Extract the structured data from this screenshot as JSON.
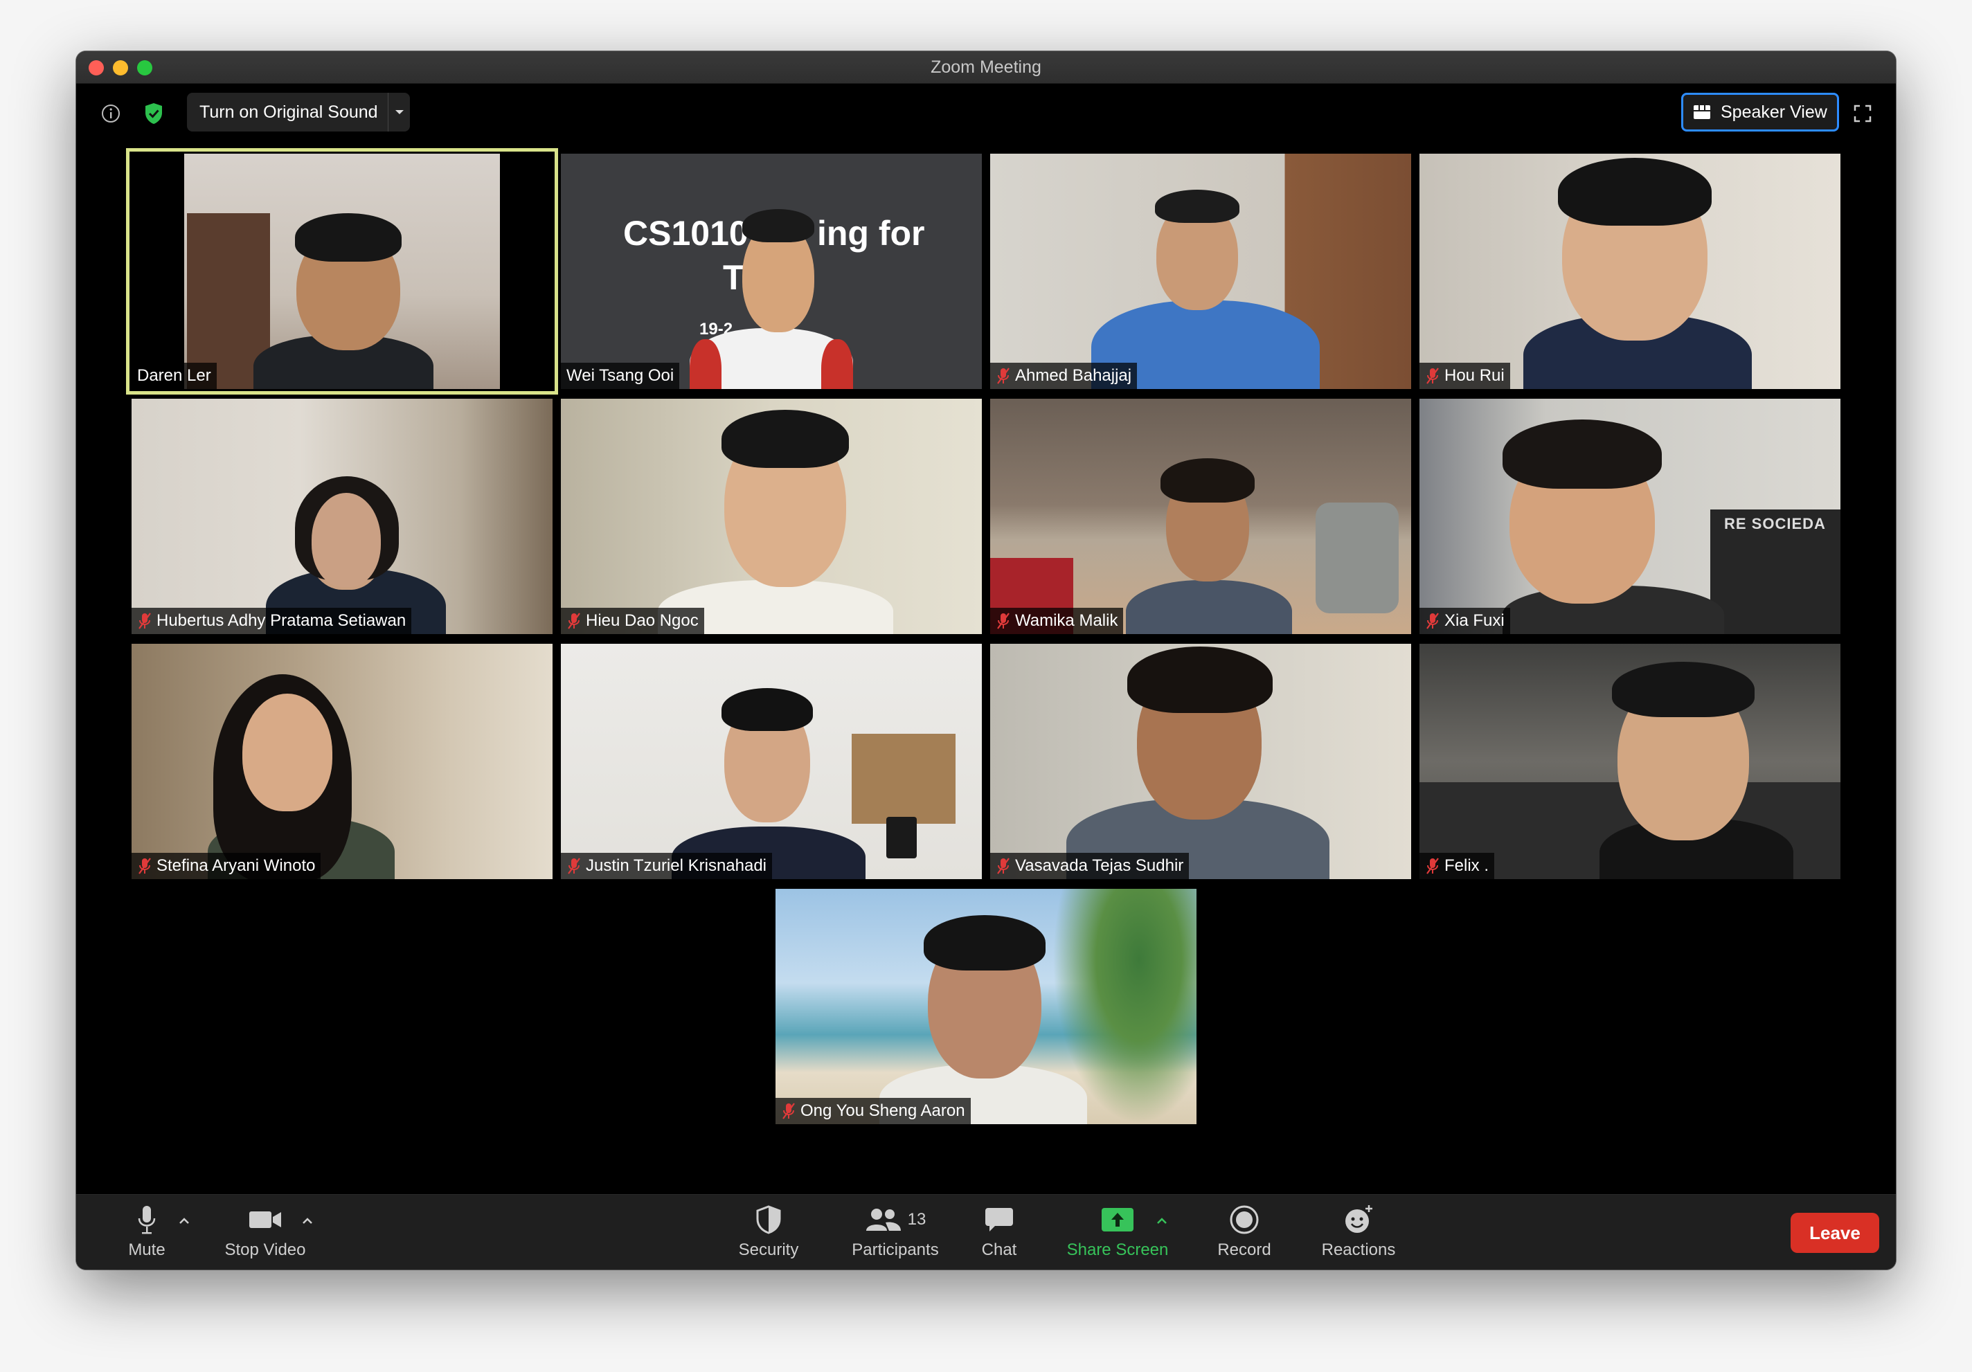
{
  "window": {
    "title": "Zoom Meeting"
  },
  "topbar": {
    "original_sound_label": "Turn on Original Sound",
    "speaker_view_label": "Speaker View",
    "shield_color": "#2dc04e",
    "accent": "#2d8cff"
  },
  "participants": [
    {
      "name": "Daren Ler",
      "muted": false,
      "active_speaker": true
    },
    {
      "name": "Wei Tsang Ooi",
      "muted": false,
      "shared_slide": {
        "title_left": "CS1010",
        "title_right": "ing for",
        "line2": "T",
        "line3": "19-2"
      }
    },
    {
      "name": "Ahmed Bahajjaj",
      "muted": true
    },
    {
      "name": "Hou Rui",
      "muted": true
    },
    {
      "name": "Hubertus Adhy Pratama Setiawan",
      "muted": true
    },
    {
      "name": "Hieu Dao Ngoc",
      "muted": true
    },
    {
      "name": "Wamika Malik",
      "muted": true
    },
    {
      "name": "Xia Fuxi",
      "muted": true,
      "background_text": "RE SOCIEDA"
    },
    {
      "name": "Stefina Aryani Winoto",
      "muted": true
    },
    {
      "name": "Justin Tzuriel Krisnahadi",
      "muted": true
    },
    {
      "name": "Vasavada Tejas Sudhir",
      "muted": true
    },
    {
      "name": "Felix .",
      "muted": true
    },
    {
      "name": "Ong You Sheng Aaron",
      "muted": true
    }
  ],
  "toolbar": {
    "mute_label": "Mute",
    "stop_video_label": "Stop Video",
    "security_label": "Security",
    "participants_label": "Participants",
    "participants_count": "13",
    "chat_label": "Chat",
    "share_screen_label": "Share Screen",
    "record_label": "Record",
    "reactions_label": "Reactions",
    "leave_label": "Leave",
    "share_color": "#37c35a",
    "leave_color": "#d93025"
  }
}
